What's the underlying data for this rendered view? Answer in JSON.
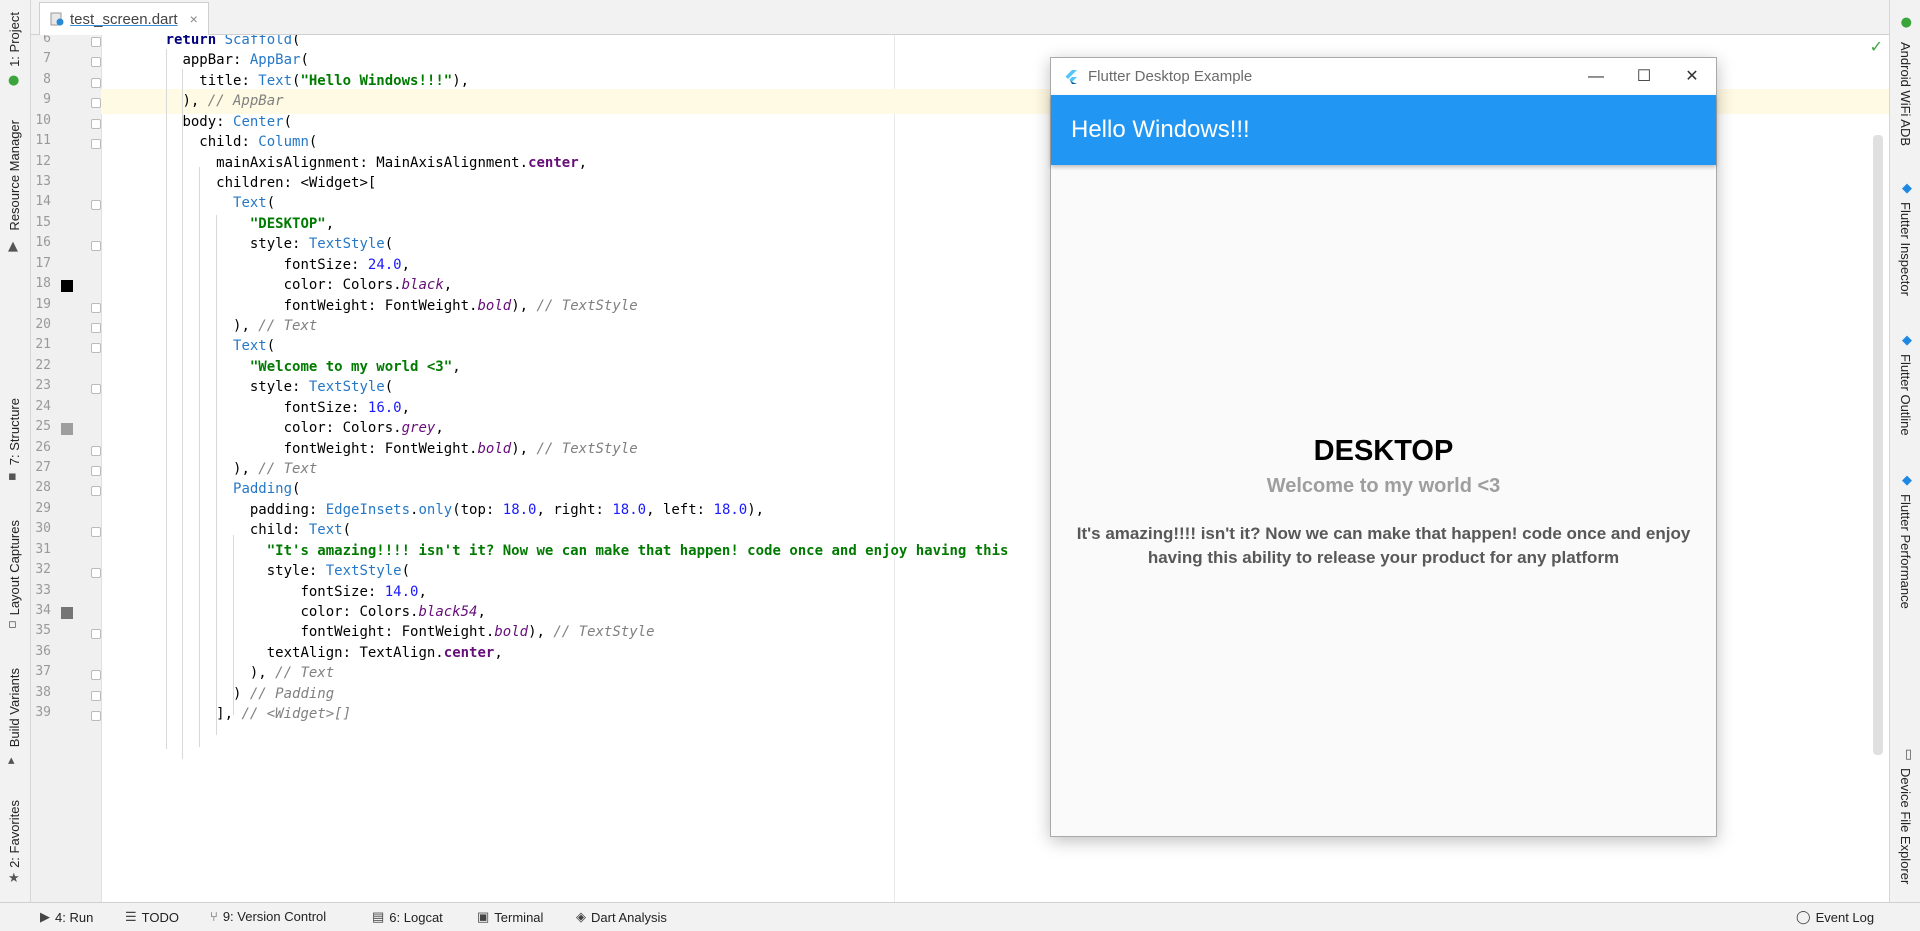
{
  "editor_tab": {
    "file_name": "test_screen.dart",
    "close": "×"
  },
  "left_tools": [
    {
      "label": "1: Project"
    },
    {
      "label": "Resource Manager"
    },
    {
      "label": "7: Structure"
    },
    {
      "label": "Layout Captures"
    },
    {
      "label": "Build Variants"
    },
    {
      "label": "2: Favorites"
    }
  ],
  "right_tools": [
    {
      "label": "Android WiFi ADB"
    },
    {
      "label": "Flutter Inspector"
    },
    {
      "label": "Flutter Outline"
    },
    {
      "label": "Flutter Performance"
    },
    {
      "label": "Device File Explorer"
    }
  ],
  "bottom_bar": {
    "run": "4: Run",
    "todo": "TODO",
    "version_control": "9: Version Control",
    "logcat": "6: Logcat",
    "terminal": "Terminal",
    "dart_analysis": "Dart Analysis",
    "event_log": "Event Log"
  },
  "code": {
    "line_numbers": [
      "6",
      "7",
      "8",
      "9",
      "10",
      "11",
      "12",
      "13",
      "14",
      "15",
      "16",
      "17",
      "18",
      "19",
      "20",
      "21",
      "22",
      "23",
      "24",
      "25",
      "26",
      "27",
      "28",
      "29",
      "30",
      "31",
      "32",
      "33",
      "34",
      "35",
      "36",
      "37",
      "38",
      "39"
    ],
    "swatch_colors": {
      "black": "#000000",
      "grey": "#9e9e9e",
      "black54": "#757575"
    }
  },
  "app_window": {
    "title": "Flutter Desktop Example",
    "minimize": "—",
    "maximize": "☐",
    "close": "✕",
    "appbar_title": "Hello Windows!!!",
    "accent_color": "#2196f3",
    "heading": "DESKTOP",
    "subheading": "Welcome to my world <3",
    "paragraph": "It's amazing!!!! isn't it? Now we can make that happen! code once and enjoy having this ability to release your product for any platform"
  }
}
